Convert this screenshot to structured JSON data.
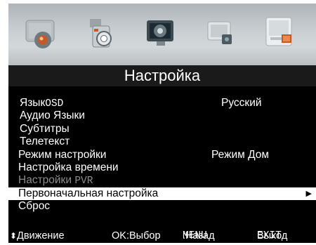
{
  "header": {
    "title": "Настройка"
  },
  "icons": [
    "picture-icon",
    "sound-icon",
    "channel-icon",
    "feature-icon",
    "setup-icon"
  ],
  "menu": {
    "items": [
      {
        "label": "Язык",
        "suffix": "OSD",
        "value": "Русский"
      },
      {
        "label": "Аудио Языки"
      },
      {
        "label": "Субтитры"
      },
      {
        "label": "Телетекст"
      },
      {
        "label": "Режим настройки",
        "value": "Режим Дом"
      },
      {
        "label": "Настройка времени"
      },
      {
        "label": "Настройки",
        "suffix": "PVR"
      },
      {
        "label": "Первоначальная настройка",
        "arrow": "▶"
      },
      {
        "label": "Сброс"
      }
    ],
    "selected_index": 7,
    "disabled_index": 6
  },
  "footer": {
    "nav_icon": "⬍",
    "move": "Движение",
    "ok": "OK:Выбор",
    "menu_key": "MENU",
    "menu_action": ":Назад",
    "exit_key": "EXIT",
    "exit_action": "Выход"
  },
  "colors": {
    "background": "#000000",
    "header_bg": "#1a1a1a",
    "text": "#ffffff",
    "selected_bg": "#ffffff",
    "selected_text": "#000000",
    "disabled_text": "#8c8c8c",
    "icon_bar": "#c9cfd3"
  }
}
